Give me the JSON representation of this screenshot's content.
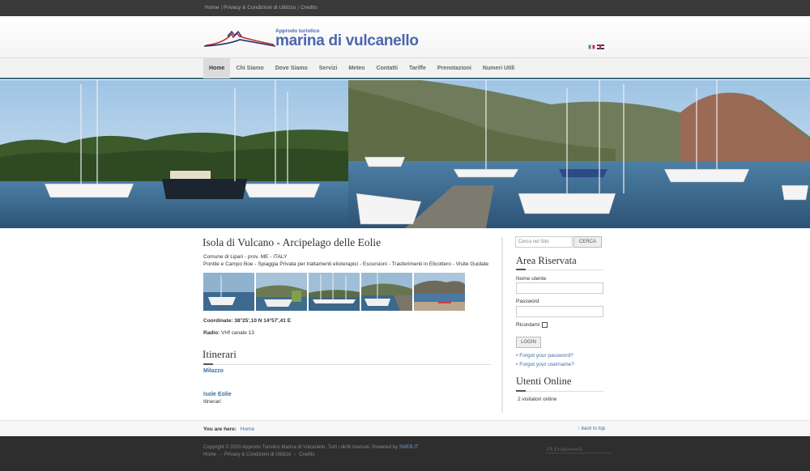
{
  "topbar": {
    "links": [
      "Home",
      "Privacy & Condizioni di Utilizzo",
      "Credits"
    ]
  },
  "header": {
    "tagline": "Approdo turistico",
    "title": "marina di vulcanello",
    "languages": [
      "Italiano",
      "English"
    ]
  },
  "nav": {
    "items": [
      "Home",
      "Chi Siamo",
      "Dove Siamo",
      "Servizi",
      "Meteo",
      "Contatti",
      "Tariffe",
      "Prenotazioni",
      "Numeri Utili"
    ],
    "active": "Home"
  },
  "article": {
    "title": "Isola di Vulcano - Arcipelago delle Eolie",
    "line1": "Comune di Lipari - prov. ME - ITALY",
    "line2": "Pontile e Campo Boe - Spiaggia Privata per trattamenti elioterapici - Escursioni - Trasferimenti in Elicottero - Visite Guidate",
    "coords_label": "Coordinate:",
    "coords_value": "38°25',10 N 14°57',41 E",
    "radio_label": "Radio:",
    "radio_value": "VHf canale 13"
  },
  "itinerari": {
    "title": "Itinerari",
    "items": [
      {
        "link": "Milazzo",
        "desc": ""
      },
      {
        "link": "Isole Eolie",
        "desc": "Itinerari"
      }
    ]
  },
  "sidebar": {
    "search_placeholder": "Cerca nel Sito",
    "search_button": "CERCA",
    "login_title": "Area Riservata",
    "username_label": "Nome utente",
    "password_label": "Password",
    "remember_label": "Ricordami",
    "login_button": "LOGIN",
    "forgot_password": "Forgot your password?",
    "forgot_username": "Forgot your username?",
    "online_title": "Utenti Online",
    "online_text": "2 visitatori online"
  },
  "breadcrumb": {
    "label": "You are here:",
    "current": "Home",
    "back_to_top": "↑ back to top"
  },
  "footer": {
    "copyright_text": "Copyright © 2020 Approdo Turistico Marina di Vulcanello. Tutti i diritti riservati. Powered by ",
    "powered_link": "3WEB.IT",
    "links": [
      "Home",
      "Privacy & Condizioni di Utilizzo",
      "Credits"
    ],
    "framework_logo": "JA Framework"
  },
  "colors": {
    "accent_blue": "#3b6ea6",
    "logo_blue": "#4a67ad",
    "nav_border": "#3e6b7a",
    "footer_bg": "#2e2e2e"
  }
}
